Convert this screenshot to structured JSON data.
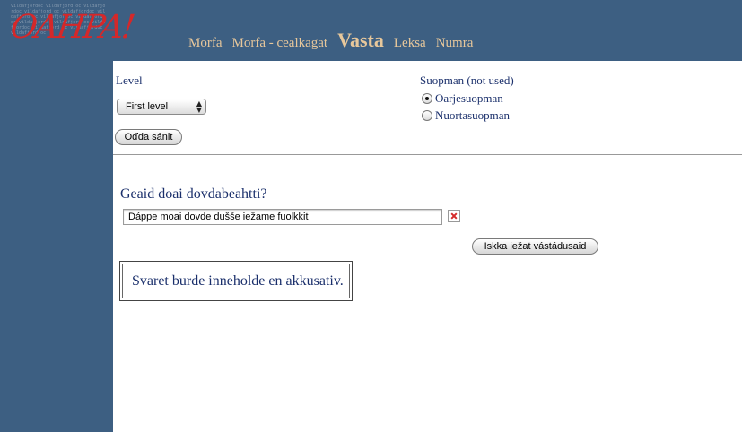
{
  "logo": {
    "text": "OAHPA!",
    "background_text": "vildafjordoc vildafjord oc vildafjordoc vildafjord oc vildafjordoc vildafjord oc vildafjordoc vildafjord oc vildafjordoc vildafjord oc vildafjordoc vildafjord oc vildafjordoc vildafjord oc"
  },
  "nav": {
    "items": [
      {
        "label": "Morfa"
      },
      {
        "label": "Morfa - cealkagat"
      },
      {
        "label": "Vasta"
      },
      {
        "label": "Leksa"
      },
      {
        "label": "Numra"
      }
    ],
    "active": "Vasta"
  },
  "settings": {
    "level_label": "Level",
    "level_selected": "First level",
    "send_button": "Oďda sánit",
    "suopman_label": "Suopman (not used)",
    "radio_options": [
      {
        "label": "Oarjesuopman",
        "checked": true
      },
      {
        "label": "Nuortasuopman",
        "checked": false
      }
    ]
  },
  "exercise": {
    "question": "Geaid doai dovdabeahtti?",
    "answer_value": "Dáppe moai dovde dušše iežame fuolkkit",
    "show_answers_button": "Iskka iežat vástádusaid",
    "feedback": "Svaret burde inneholde en akkusativ."
  },
  "colors": {
    "sidebar_bg": "#3d5f82",
    "nav_link": "#e7c79b",
    "text_blue": "#1a2f6b",
    "logo_red": "#d4282a"
  }
}
